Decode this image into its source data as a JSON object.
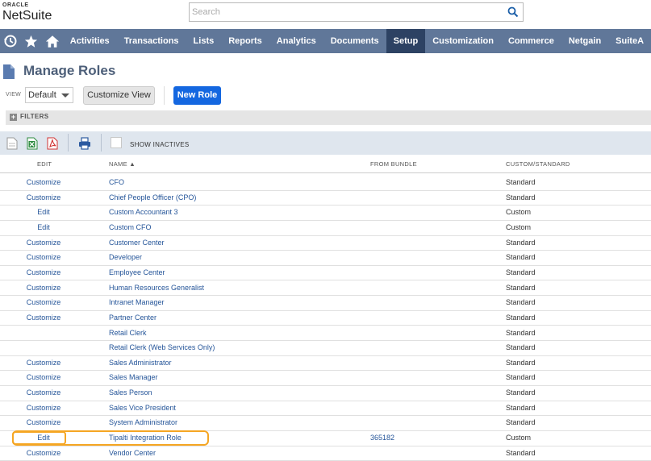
{
  "brand": {
    "oracle": "ORACLE",
    "netsuite": "NetSuite"
  },
  "search": {
    "placeholder": "Search"
  },
  "nav": {
    "icons": [
      "recent-icon",
      "star-icon",
      "home-icon"
    ],
    "items": [
      "Activities",
      "Transactions",
      "Lists",
      "Reports",
      "Analytics",
      "Documents",
      "Setup",
      "Customization",
      "Commerce",
      "Netgain",
      "SuiteA"
    ],
    "active": "Setup"
  },
  "page": {
    "title": "Manage Roles"
  },
  "view": {
    "label": "VIEW",
    "selected": "Default",
    "customize_label": "Customize View",
    "new_role_label": "New Role"
  },
  "filters": {
    "label": "FILTERS"
  },
  "toolbar": {
    "show_inactives": "SHOW INACTIVES"
  },
  "table": {
    "headers": {
      "edit": "EDIT",
      "name": "NAME ▲",
      "from_bundle": "FROM BUNDLE",
      "type": "CUSTOM/STANDARD"
    },
    "rows": [
      {
        "action": "Customize",
        "name": "CFO",
        "bundle": "",
        "type": "Standard"
      },
      {
        "action": "Customize",
        "name": "Chief People Officer (CPO)",
        "bundle": "",
        "type": "Standard"
      },
      {
        "action": "Edit",
        "name": "Custom Accountant 3",
        "bundle": "",
        "type": "Custom"
      },
      {
        "action": "Edit",
        "name": "Custom CFO",
        "bundle": "",
        "type": "Custom"
      },
      {
        "action": "Customize",
        "name": "Customer Center",
        "bundle": "",
        "type": "Standard"
      },
      {
        "action": "Customize",
        "name": "Developer",
        "bundle": "",
        "type": "Standard"
      },
      {
        "action": "Customize",
        "name": "Employee Center",
        "bundle": "",
        "type": "Standard"
      },
      {
        "action": "Customize",
        "name": "Human Resources Generalist",
        "bundle": "",
        "type": "Standard"
      },
      {
        "action": "Customize",
        "name": "Intranet Manager",
        "bundle": "",
        "type": "Standard"
      },
      {
        "action": "Customize",
        "name": "Partner Center",
        "bundle": "",
        "type": "Standard"
      },
      {
        "action": "",
        "name": "Retail Clerk",
        "bundle": "",
        "type": "Standard"
      },
      {
        "action": "",
        "name": "Retail Clerk (Web Services Only)",
        "bundle": "",
        "type": "Standard"
      },
      {
        "action": "Customize",
        "name": "Sales Administrator",
        "bundle": "",
        "type": "Standard"
      },
      {
        "action": "Customize",
        "name": "Sales Manager",
        "bundle": "",
        "type": "Standard"
      },
      {
        "action": "Customize",
        "name": "Sales Person",
        "bundle": "",
        "type": "Standard"
      },
      {
        "action": "Customize",
        "name": "Sales Vice President",
        "bundle": "",
        "type": "Standard"
      },
      {
        "action": "Customize",
        "name": "System Administrator",
        "bundle": "",
        "type": "Standard"
      },
      {
        "action": "Edit",
        "name": "Tipalti Integration Role",
        "bundle": "365182",
        "type": "Custom"
      },
      {
        "action": "Customize",
        "name": "Vendor Center",
        "bundle": "",
        "type": "Standard"
      }
    ]
  },
  "colors": {
    "nav_bg": "#607799",
    "nav_active": "#2d4263",
    "link": "#255599",
    "primary_button": "#1467e0",
    "highlight": "#f5a623"
  }
}
